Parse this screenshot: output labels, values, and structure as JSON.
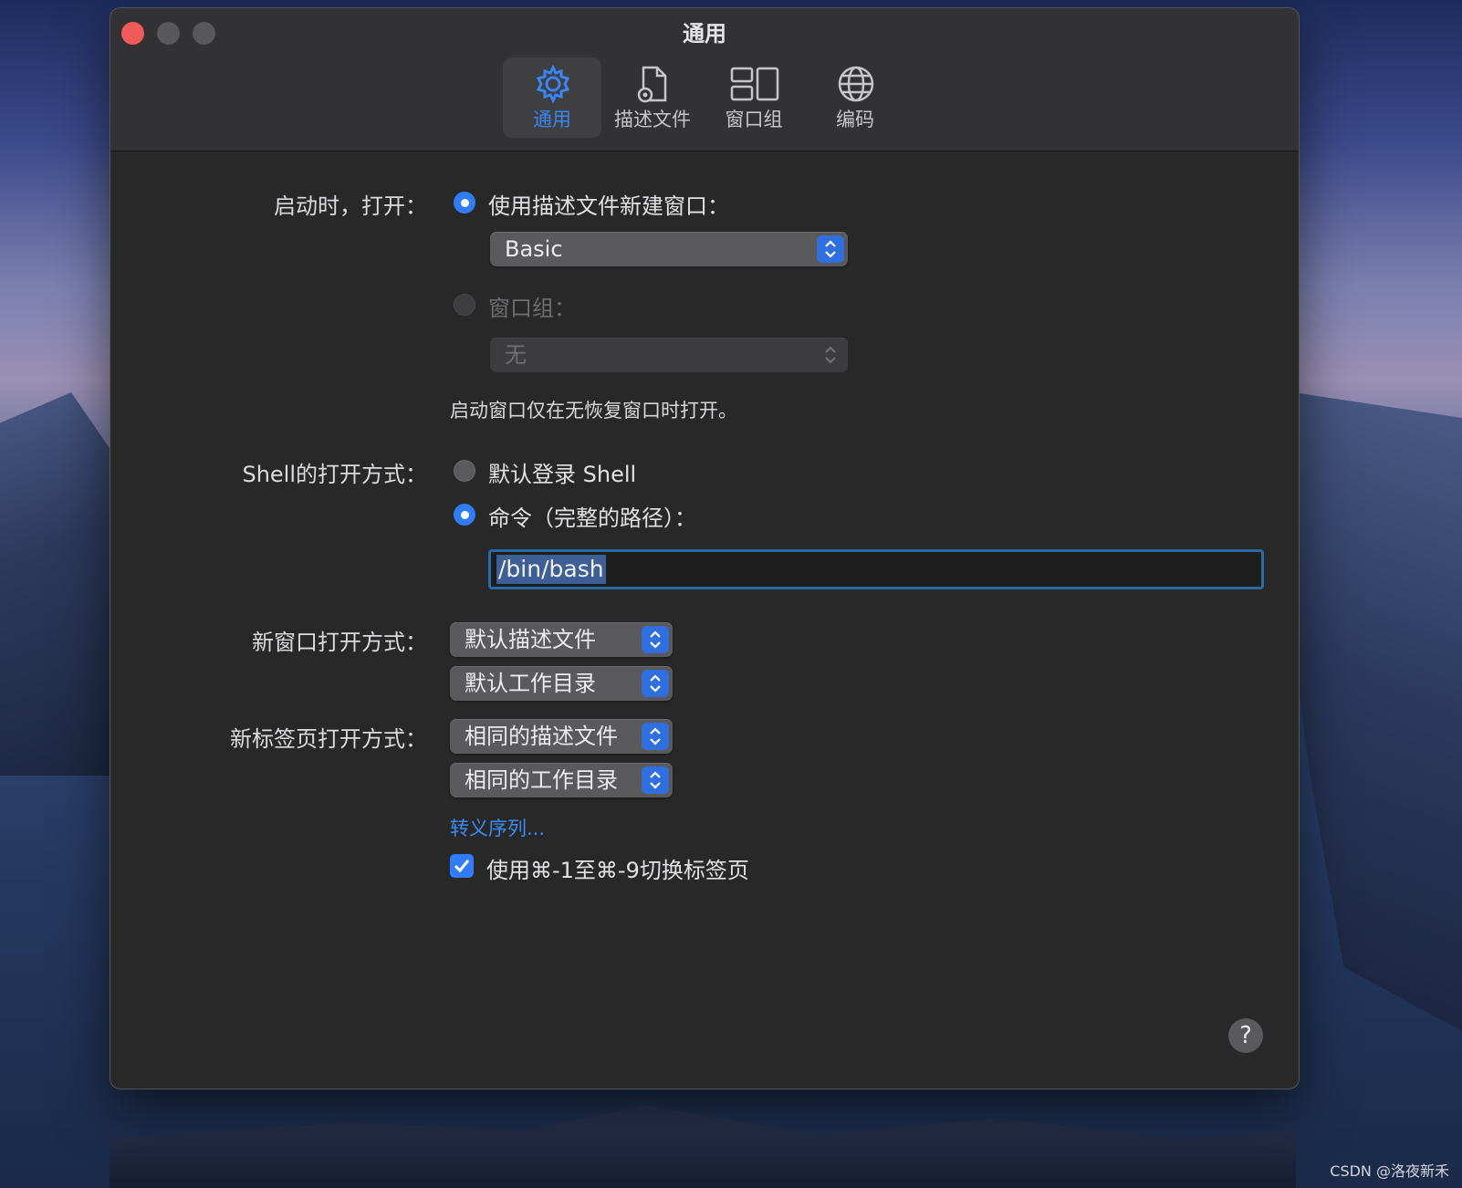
{
  "window": {
    "title": "通用"
  },
  "toolbar": {
    "tabs": [
      {
        "label": "通用",
        "icon": "gear-icon",
        "active": true
      },
      {
        "label": "描述文件",
        "icon": "document-gear-icon",
        "active": false
      },
      {
        "label": "窗口组",
        "icon": "window-group-icon",
        "active": false
      },
      {
        "label": "编码",
        "icon": "globe-icon",
        "active": false
      }
    ]
  },
  "startup": {
    "label": "启动时，打开：",
    "option_profile": "使用描述文件新建窗口：",
    "profile_value": "Basic",
    "option_group": "窗口组：",
    "group_value": "无",
    "note": "启动窗口仅在无恢复窗口时打开。"
  },
  "shell": {
    "label": "Shell的打开方式：",
    "option_default": "默认登录 Shell",
    "option_command": "命令（完整的路径）：",
    "command_value": "/bin/bash"
  },
  "new_window": {
    "label": "新窗口打开方式：",
    "profile": "默认描述文件",
    "directory": "默认工作目录"
  },
  "new_tab": {
    "label": "新标签页打开方式：",
    "profile": "相同的描述文件",
    "directory": "相同的工作目录"
  },
  "escape_link": "转义序列...",
  "tab_switch_checkbox": {
    "label": "使用⌘-1至⌘-9切换标签页",
    "checked": true
  },
  "help_button": "?",
  "watermark": "CSDN @洛夜新禾",
  "colors": {
    "accent": "#2f7cf6",
    "window_bg": "#282829",
    "titlebar_bg": "#323234"
  }
}
